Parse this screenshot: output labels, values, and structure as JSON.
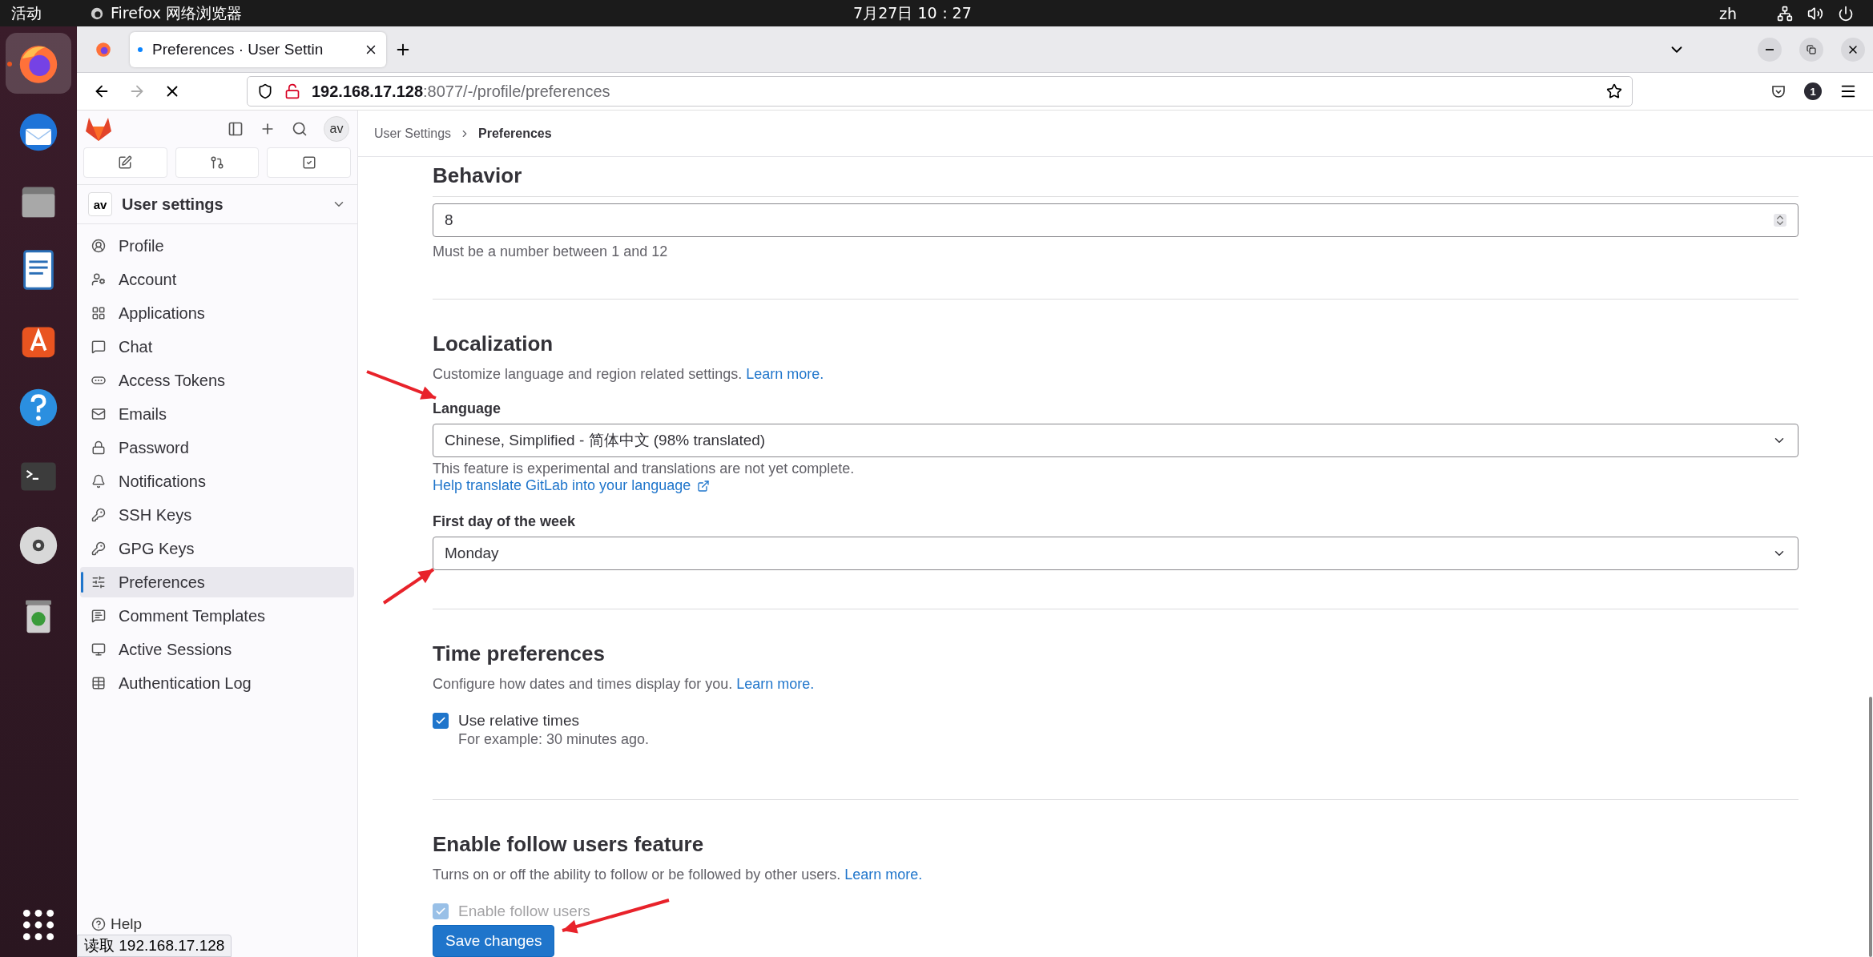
{
  "top_bar": {
    "activities": "活动",
    "app_name": "Firefox 网络浏览器",
    "clock": "7月27日  10：27",
    "language": "zh"
  },
  "dock": {
    "items": [
      {
        "selected": true
      },
      {
        "selected": false
      },
      {
        "selected": false
      },
      {
        "selected": false
      },
      {
        "selected": false
      },
      {
        "selected": false
      },
      {
        "selected": false
      },
      {
        "selected": false
      },
      {
        "selected": false
      }
    ]
  },
  "browser": {
    "tab_title": "Preferences · User Settin",
    "url_host": "192.168.17.128",
    "url_rest": ":8077/-/profile/preferences",
    "badge": "1",
    "status": "读取 192.168.17.128"
  },
  "sidebar": {
    "avatar": "av",
    "context_avatar": "av",
    "context_title": "User settings",
    "items": [
      {
        "label": "Profile",
        "selected": false
      },
      {
        "label": "Account",
        "selected": false
      },
      {
        "label": "Applications",
        "selected": false
      },
      {
        "label": "Chat",
        "selected": false
      },
      {
        "label": "Access Tokens",
        "selected": false
      },
      {
        "label": "Emails",
        "selected": false
      },
      {
        "label": "Password",
        "selected": false
      },
      {
        "label": "Notifications",
        "selected": false
      },
      {
        "label": "SSH Keys",
        "selected": false
      },
      {
        "label": "GPG Keys",
        "selected": false
      },
      {
        "label": "Preferences",
        "selected": true
      },
      {
        "label": "Comment Templates",
        "selected": false
      },
      {
        "label": "Active Sessions",
        "selected": false
      },
      {
        "label": "Authentication Log",
        "selected": false
      }
    ],
    "help": "Help"
  },
  "breadcrumb": [
    "User Settings",
    "Preferences"
  ],
  "behavior": {
    "title": "Behavior",
    "value": "8",
    "hint": "Must be a number between 1 and 12"
  },
  "localization": {
    "title": "Localization",
    "description": "Customize language and region related settings.",
    "link": "Learn more.",
    "language_label": "Language",
    "language_value": "Chinese, Simplified - 简体中文 (98% translated)",
    "language_note": "This feature is experimental and translations are not yet complete.",
    "translate_link": "Help translate GitLab into your language",
    "week_label": "First day of the week",
    "week_value": "Monday"
  },
  "time_preferences": {
    "title": "Time preferences",
    "description": "Configure how dates and times display for you.",
    "link": "Learn more.",
    "checkbox_label": "Use relative times",
    "checked": true,
    "example": "For example: 30 minutes ago."
  },
  "follow": {
    "title": "Enable follow users feature",
    "description": "Turns on or off the ability to follow or be followed by other users.",
    "link": "Learn more.",
    "checkbox_label": "Enable follow users",
    "checked": true
  },
  "save_button": "Save changes"
}
